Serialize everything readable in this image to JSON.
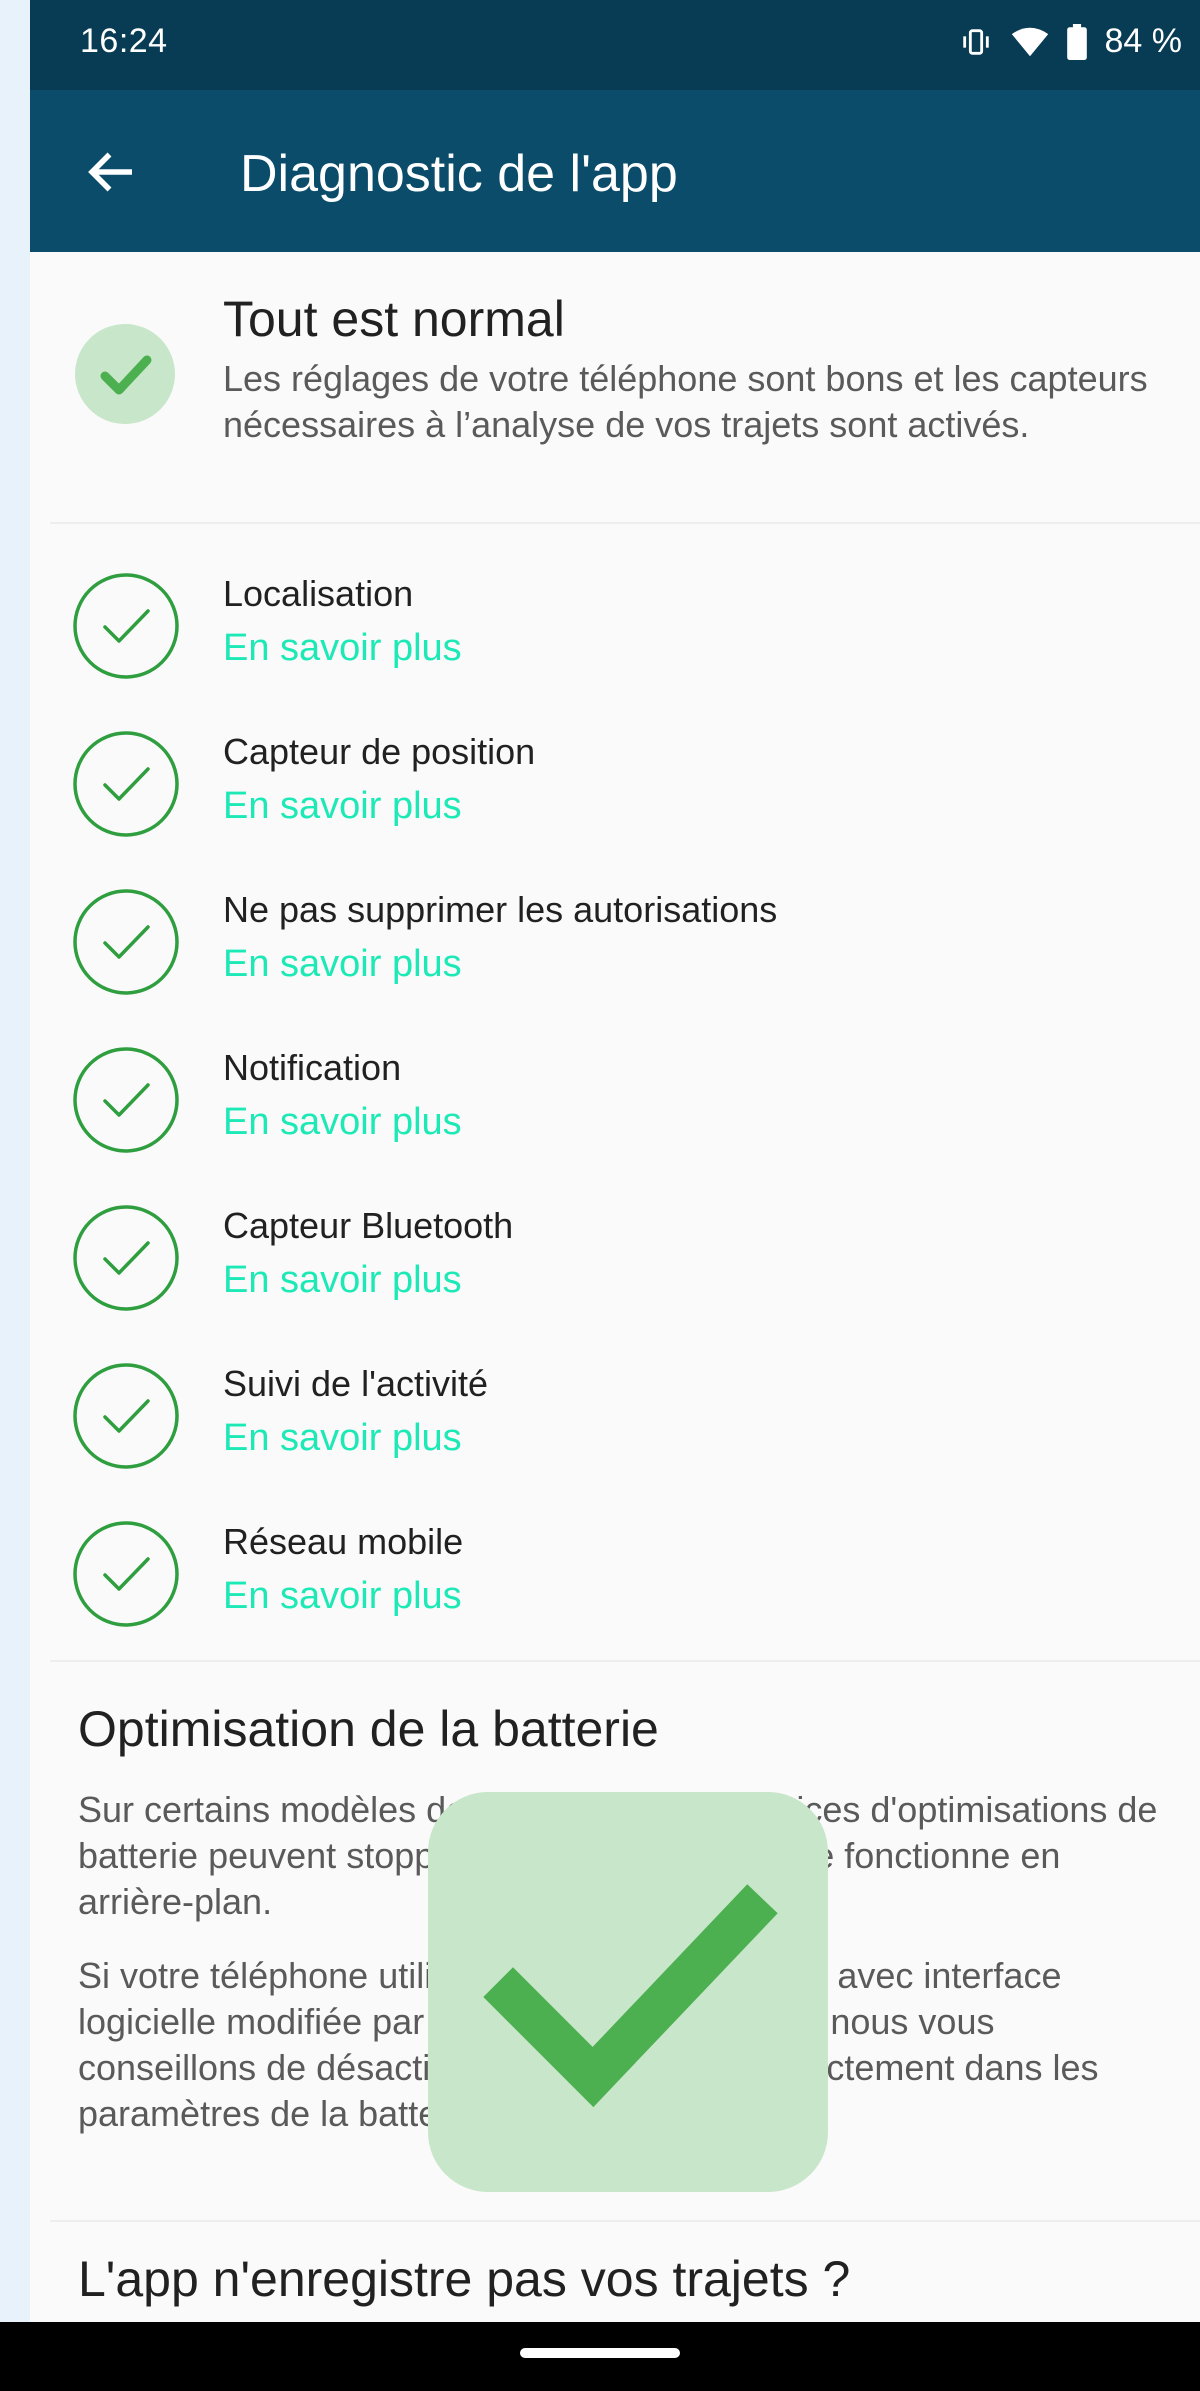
{
  "status_bar": {
    "time": "16:24",
    "battery": "84 %",
    "icons": [
      "vibrate-icon",
      "wifi-icon",
      "battery-icon"
    ]
  },
  "app_bar": {
    "title": "Diagnostic de l'app",
    "back_icon": "arrow-left-icon"
  },
  "summary": {
    "title": "Tout est normal",
    "description": "Les réglages de votre téléphone sont bons et les capteurs nécessaires à l’analyse de vos trajets sont activés.",
    "icon": "check-circle-icon"
  },
  "checks": [
    {
      "label": "Localisation",
      "link": "En savoir plus"
    },
    {
      "label": "Capteur de position",
      "link": "En savoir plus"
    },
    {
      "label": "Ne pas supprimer les autorisations",
      "link": "En savoir plus"
    },
    {
      "label": "Notification",
      "link": "En savoir plus"
    },
    {
      "label": "Capteur Bluetooth",
      "link": "En savoir plus"
    },
    {
      "label": "Suivi de l'activité",
      "link": "En savoir plus"
    },
    {
      "label": "Réseau mobile",
      "link": "En savoir plus"
    }
  ],
  "battery_section": {
    "title": "Optimisation de la batterie",
    "paragraph1": "Sur certains modèles de téléphones, les services d'optimisations de batterie peuvent stopper l'application lorsqu'elle fonctionne en arrière-plan.",
    "paragraph2": "Si votre téléphone utilise une version d'Android avec interface logicielle modifiée par le fabricant (surcouche), nous vous conseillons de désactiver les optimisations directement dans les paramètres de la batterie."
  },
  "trips_section": {
    "title": "L'app n'enregistre pas vos trajets ?"
  },
  "colors": {
    "status_bar": "#083b54",
    "app_bar": "#0b4c6b",
    "check_green": "#2e9e3f",
    "link_teal": "#1de9b6",
    "overlay_green": "#c8e6c9"
  }
}
